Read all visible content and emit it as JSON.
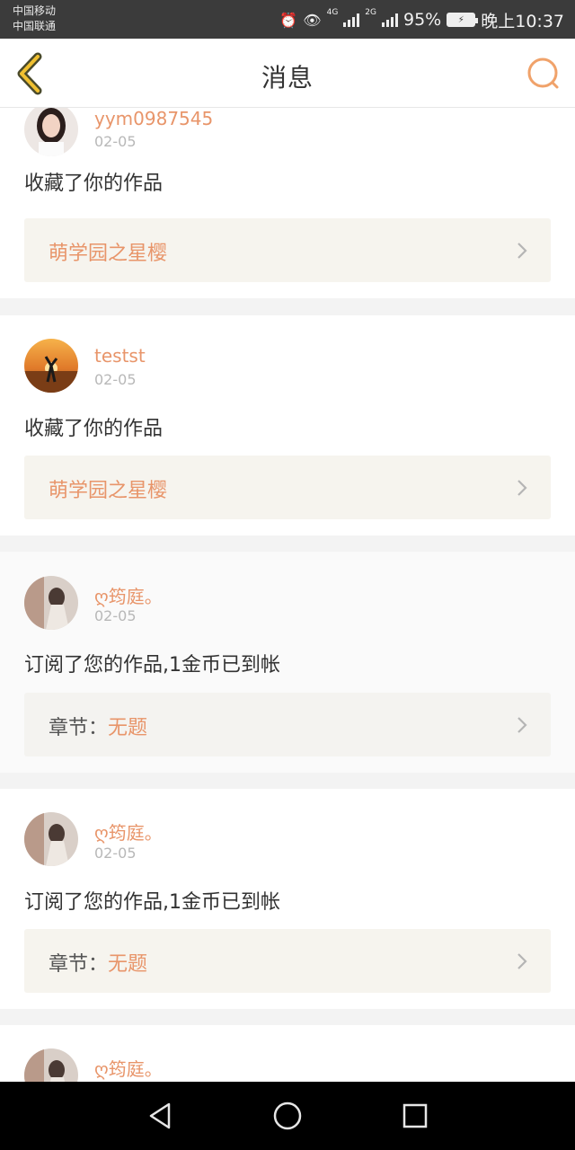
{
  "status_bar": {
    "carrier_1": "中国移动",
    "carrier_2": "中国联通",
    "net_1": "4G",
    "net_2": "2G",
    "battery": "95%",
    "time": "晚上10:37",
    "icons": [
      "alarm-icon",
      "eye-icon",
      "signal-icon",
      "battery-icon"
    ]
  },
  "header": {
    "title": "消息",
    "back_icon": "back-chevron-icon",
    "search_icon": "search-icon",
    "accent_color": "#e8956a"
  },
  "messages": [
    {
      "name": "yym0987545",
      "date": "02-05",
      "action": "收藏了你的作品",
      "work_prefix": "",
      "work_title": "萌学园之星樱"
    },
    {
      "name": "testst",
      "date": "02-05",
      "action": "收藏了你的作品",
      "work_prefix": "",
      "work_title": "萌学园之星樱"
    },
    {
      "name": "ღ筠庭。",
      "date": "02-05",
      "action": "订阅了您的作品,1金币已到帐",
      "work_prefix": "章节：",
      "work_title": "无题"
    },
    {
      "name": "ღ筠庭。",
      "date": "02-05",
      "action": "订阅了您的作品,1金币已到帐",
      "work_prefix": "章节：",
      "work_title": "无题"
    },
    {
      "name": "ღ筠庭。",
      "date": "",
      "action": "",
      "work_prefix": "",
      "work_title": ""
    }
  ],
  "nav_bar": {
    "icons": [
      "back-triangle-icon",
      "home-circle-icon",
      "recents-square-icon"
    ]
  }
}
